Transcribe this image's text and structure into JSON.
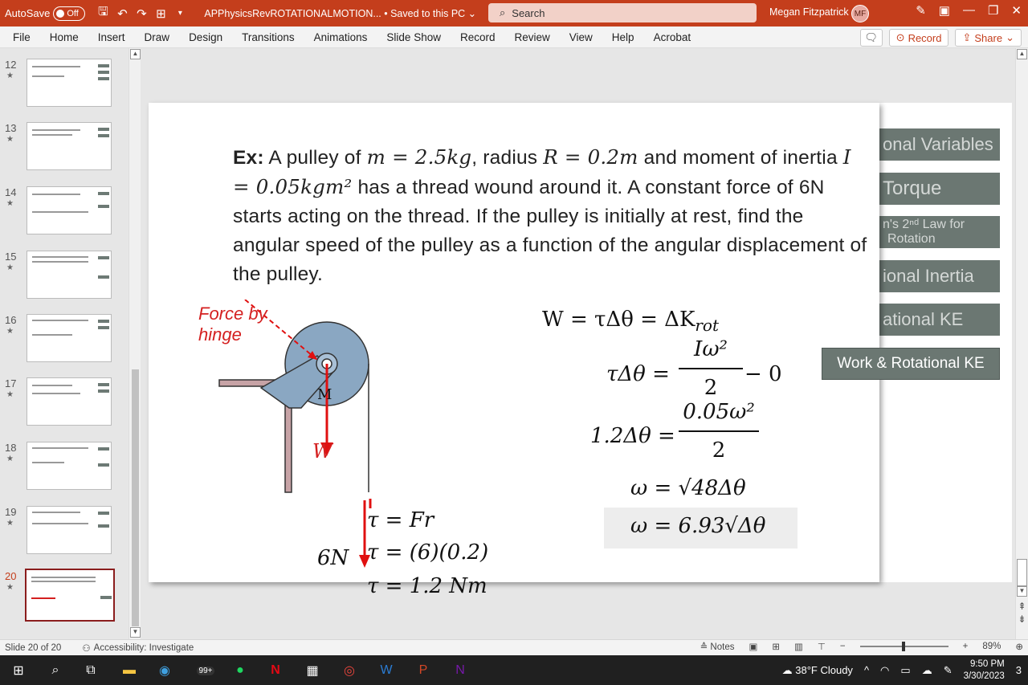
{
  "titlebar": {
    "autosave_label": "AutoSave",
    "autosave_state": "Off",
    "doc_title": "APPhysicsRevROTATIONALMOTION... • Saved to this PC ⌄",
    "search_placeholder": "Search",
    "user_name": "Megan Fitzpatrick",
    "user_initials": "MF"
  },
  "ribbon": {
    "tabs": [
      "File",
      "Home",
      "Insert",
      "Draw",
      "Design",
      "Transitions",
      "Animations",
      "Slide Show",
      "Record",
      "Review",
      "View",
      "Help",
      "Acrobat"
    ],
    "record_label": "Record",
    "share_label": "Share"
  },
  "thumbnails": [
    {
      "num": "12",
      "star": "★"
    },
    {
      "num": "13",
      "star": "★"
    },
    {
      "num": "14",
      "star": "★"
    },
    {
      "num": "15",
      "star": "★"
    },
    {
      "num": "16",
      "star": "★"
    },
    {
      "num": "17",
      "star": "★"
    },
    {
      "num": "18",
      "star": "★"
    },
    {
      "num": "19",
      "star": "★"
    },
    {
      "num": "20",
      "star": "★"
    }
  ],
  "slide": {
    "problem_bold": "Ex:",
    "problem_text_1": " A pulley of ",
    "m_eq": "m = 2.5kg",
    "problem_text_2": ", radius ",
    "r_eq": "R = 0.2m",
    "problem_text_3": " and moment of inertia ",
    "i_eq": "I = 0.05kgm²",
    "problem_text_4": " has a thread wound around it. A constant force of 6N starts acting on the thread. If the pulley is initially at rest, find the angular speed of the pulley as a function of the angular displacement of the pulley.",
    "force_label_1": "Force by",
    "force_label_2": "hinge",
    "w_label": "W",
    "m_label": "M",
    "six_n": "6N",
    "torque_1": "τ = Fr",
    "torque_2": "τ = (6)(0.2)",
    "torque_3": "τ = 1.2 Nm",
    "work_eq_lhs": "W = τΔθ = ΔK",
    "work_eq_sub": "rot",
    "eq2_lhs": "τΔθ =",
    "eq2_num": "Iω²",
    "eq2_den": "2",
    "eq2_rhs": "− 0",
    "eq3_lhs": "1.2Δθ =",
    "eq3_num": "0.05ω²",
    "eq3_den": "2",
    "eq4": "ω = √48Δθ",
    "eq5": "ω = 6.93√Δθ"
  },
  "side_menu": {
    "items": [
      "onal Variables",
      "Torque",
      "n's 2ⁿᵈ Law for",
      "Rotation",
      "ional Inertia",
      "ational KE"
    ],
    "active": "Work & Rotational KE"
  },
  "status": {
    "slide_count": "Slide 20 of 20",
    "accessibility": "Accessibility: Investigate",
    "notes": "Notes",
    "zoom": "89%"
  },
  "taskbar": {
    "weather": "38°F  Cloudy",
    "time": "9:50 PM",
    "date": "3/30/2023",
    "badge": "99+",
    "notif": "3"
  },
  "colors": {
    "titlebar": "#c43e1c",
    "side_menu": "#6b7772",
    "annotation_red": "#d42020"
  }
}
